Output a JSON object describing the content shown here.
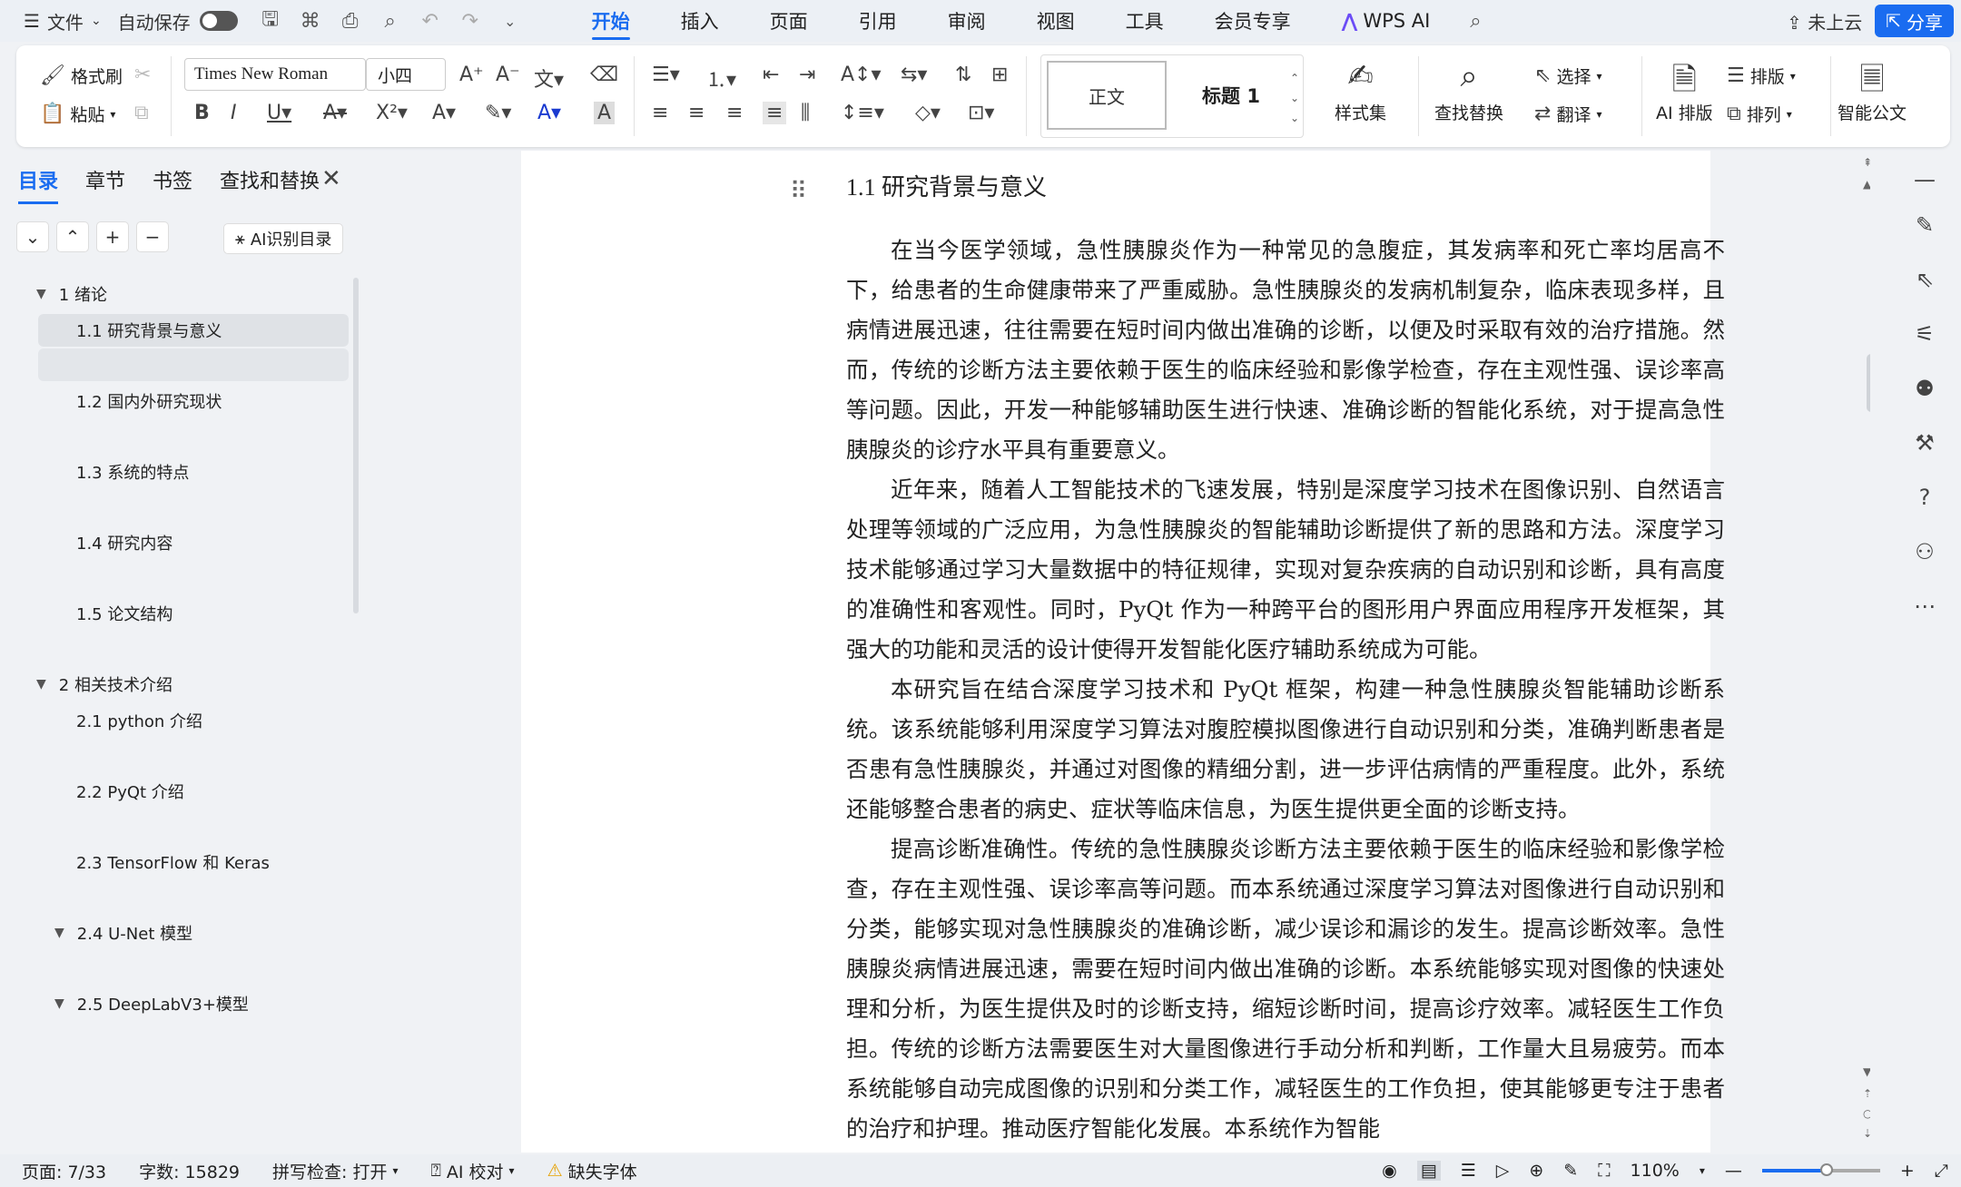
{
  "topbar": {
    "file_menu": "文件",
    "autosave_label": "自动保存",
    "tabs": [
      "开始",
      "插入",
      "页面",
      "引用",
      "审阅",
      "视图",
      "工具",
      "会员专享"
    ],
    "wps_ai": "WPS AI",
    "cloud_status": "未上云",
    "share": "分享"
  },
  "ribbon": {
    "format_painter": "格式刷",
    "paste": "粘贴",
    "font_name": "Times New Roman",
    "font_size": "小四",
    "style_normal": "正文",
    "style_heading1": "标题 1",
    "style_set": "样式集",
    "find_replace": "查找替换",
    "select": "选择",
    "translate": "翻译",
    "ai_layout": "AI 排版",
    "typeset": "排版",
    "arrange": "排列",
    "smart_doc": "智能公文"
  },
  "leftpanel": {
    "tabs": [
      "目录",
      "章节",
      "书签",
      "查找和替换"
    ],
    "ai_toc": "AI识别目录",
    "toc": [
      {
        "label": "1 绪论",
        "level": 1,
        "expanded": true
      },
      {
        "label": "1.1 研究背景与意义",
        "level": 2,
        "selected": true
      },
      {
        "label": "1.2 国内外研究现状",
        "level": 2
      },
      {
        "label": "1.3 系统的特点",
        "level": 2
      },
      {
        "label": "1.4 研究内容",
        "level": 2
      },
      {
        "label": "1.5 论文结构",
        "level": 2
      },
      {
        "label": "2 相关技术介绍",
        "level": 1,
        "expanded": true
      },
      {
        "label": "2.1 python 介绍",
        "level": 2
      },
      {
        "label": "2.2 PyQt 介绍",
        "level": 2
      },
      {
        "label": "2.3 TensorFlow 和 Keras",
        "level": 2
      },
      {
        "label": "2.4 U-Net 模型",
        "level": 2,
        "expandable": true
      },
      {
        "label": "2.5 DeepLabV3+模型",
        "level": 2,
        "expandable": true
      }
    ]
  },
  "document": {
    "heading": "1.1 研究背景与意义",
    "paragraphs": [
      "在当今医学领域，急性胰腺炎作为一种常见的急腹症，其发病率和死亡率均居高不下，给患者的生命健康带来了严重威胁。急性胰腺炎的发病机制复杂，临床表现多样，且病情进展迅速，往往需要在短时间内做出准确的诊断，以便及时采取有效的治疗措施。然而，传统的诊断方法主要依赖于医生的临床经验和影像学检查，存在主观性强、误诊率高等问题。因此，开发一种能够辅助医生进行快速、准确诊断的智能化系统，对于提高急性胰腺炎的诊疗水平具有重要意义。",
      "近年来，随着人工智能技术的飞速发展，特别是深度学习技术在图像识别、自然语言处理等领域的广泛应用，为急性胰腺炎的智能辅助诊断提供了新的思路和方法。深度学习技术能够通过学习大量数据中的特征规律，实现对复杂疾病的自动识别和诊断，具有高度的准确性和客观性。同时，PyQt 作为一种跨平台的图形用户界面应用程序开发框架，其强大的功能和灵活的设计使得开发智能化医疗辅助系统成为可能。",
      "本研究旨在结合深度学习技术和 PyQt 框架，构建一种急性胰腺炎智能辅助诊断系统。该系统能够利用深度学习算法对腹腔模拟图像进行自动识别和分类，准确判断患者是否患有急性胰腺炎，并通过对图像的精细分割，进一步评估病情的严重程度。此外，系统还能够整合患者的病史、症状等临床信息，为医生提供更全面的诊断支持。",
      "提高诊断准确性。传统的急性胰腺炎诊断方法主要依赖于医生的临床经验和影像学检查，存在主观性强、误诊率高等问题。而本系统通过深度学习算法对图像进行自动识别和分类，能够实现对急性胰腺炎的准确诊断，减少误诊和漏诊的发生。提高诊断效率。急性胰腺炎病情进展迅速，需要在短时间内做出准确的诊断。本系统能够实现对图像的快速处理和分析，为医生提供及时的诊断支持，缩短诊断时间，提高诊疗效率。减轻医生工作负担。传统的诊断方法需要医生对大量图像进行手动分析和判断，工作量大且易疲劳。而本系统能够自动完成图像的识别和分类工作，减轻医生的工作负担，使其能够更专注于患者的治疗和护理。推动医疗智能化发展。本系统作为智能"
    ]
  },
  "statusbar": {
    "page": "页面: 7/33",
    "words": "字数: 15829",
    "spellcheck": "拼写检查: 打开",
    "ai_proof": "AI 校对",
    "missing_font": "缺失字体",
    "zoom": "110%",
    "zoom_fraction": 0.55
  },
  "colors": {
    "accent": "#1a6cf0",
    "panel_bg": "#f0f2f5",
    "page_bg": "#ffffff"
  }
}
